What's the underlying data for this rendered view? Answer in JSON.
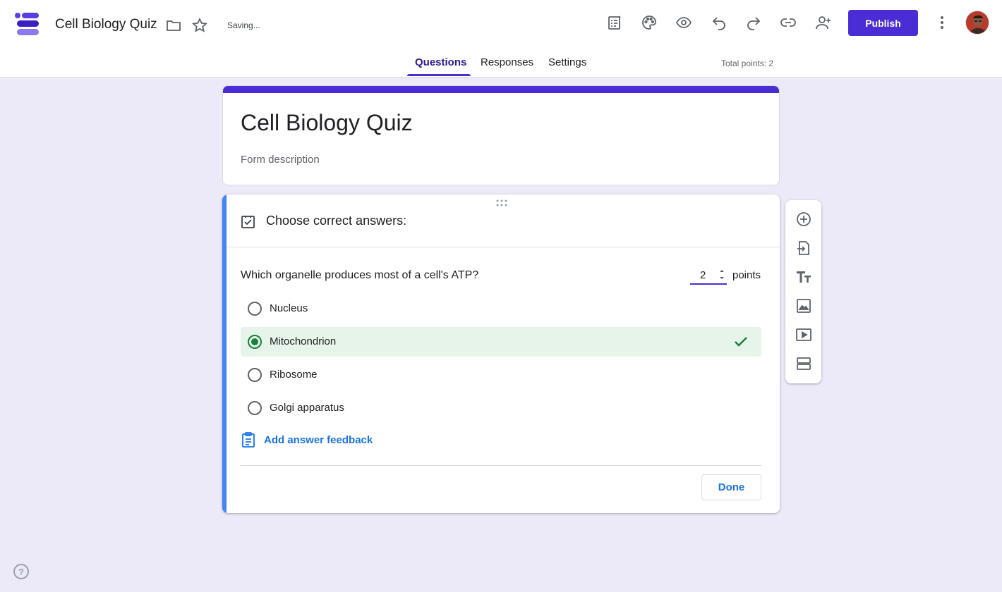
{
  "header": {
    "title": "Cell Biology Quiz",
    "status": "Saving...",
    "publish_label": "Publish",
    "icons": [
      "folder-icon",
      "star-icon",
      "customize-icon",
      "palette-icon",
      "preview-icon",
      "undo-icon",
      "redo-icon",
      "link-icon",
      "add-collaborator-icon",
      "more-vert-icon"
    ]
  },
  "tabs": [
    {
      "label": "Questions",
      "active": true
    },
    {
      "label": "Responses",
      "active": false
    },
    {
      "label": "Settings",
      "active": false
    }
  ],
  "total_points": "Total points: 2",
  "form": {
    "title": "Cell Biology Quiz",
    "description_placeholder": "Form description"
  },
  "question_card": {
    "mode_label": "Choose correct answers:",
    "question": "Which organelle produces most of a cell's ATP?",
    "points_value": "2",
    "points_label": "points",
    "options": [
      {
        "label": "Nucleus",
        "correct": false
      },
      {
        "label": "Mitochondrion",
        "correct": true
      },
      {
        "label": "Ribosome",
        "correct": false
      },
      {
        "label": "Golgi apparatus",
        "correct": false
      }
    ],
    "feedback_label": "Add answer feedback",
    "done_label": "Done"
  },
  "side_toolbar": [
    "add-question-icon",
    "import-questions-icon",
    "add-title-icon",
    "add-image-icon",
    "add-video-icon",
    "add-section-icon"
  ],
  "help_glyph": "?",
  "colors": {
    "accent": "#4b2dd6",
    "background": "#ece9f9",
    "question_bar": "#4285f4",
    "correct_bg": "#e6f4ea",
    "correct_green": "#188038",
    "link_blue": "#1a73e8"
  }
}
